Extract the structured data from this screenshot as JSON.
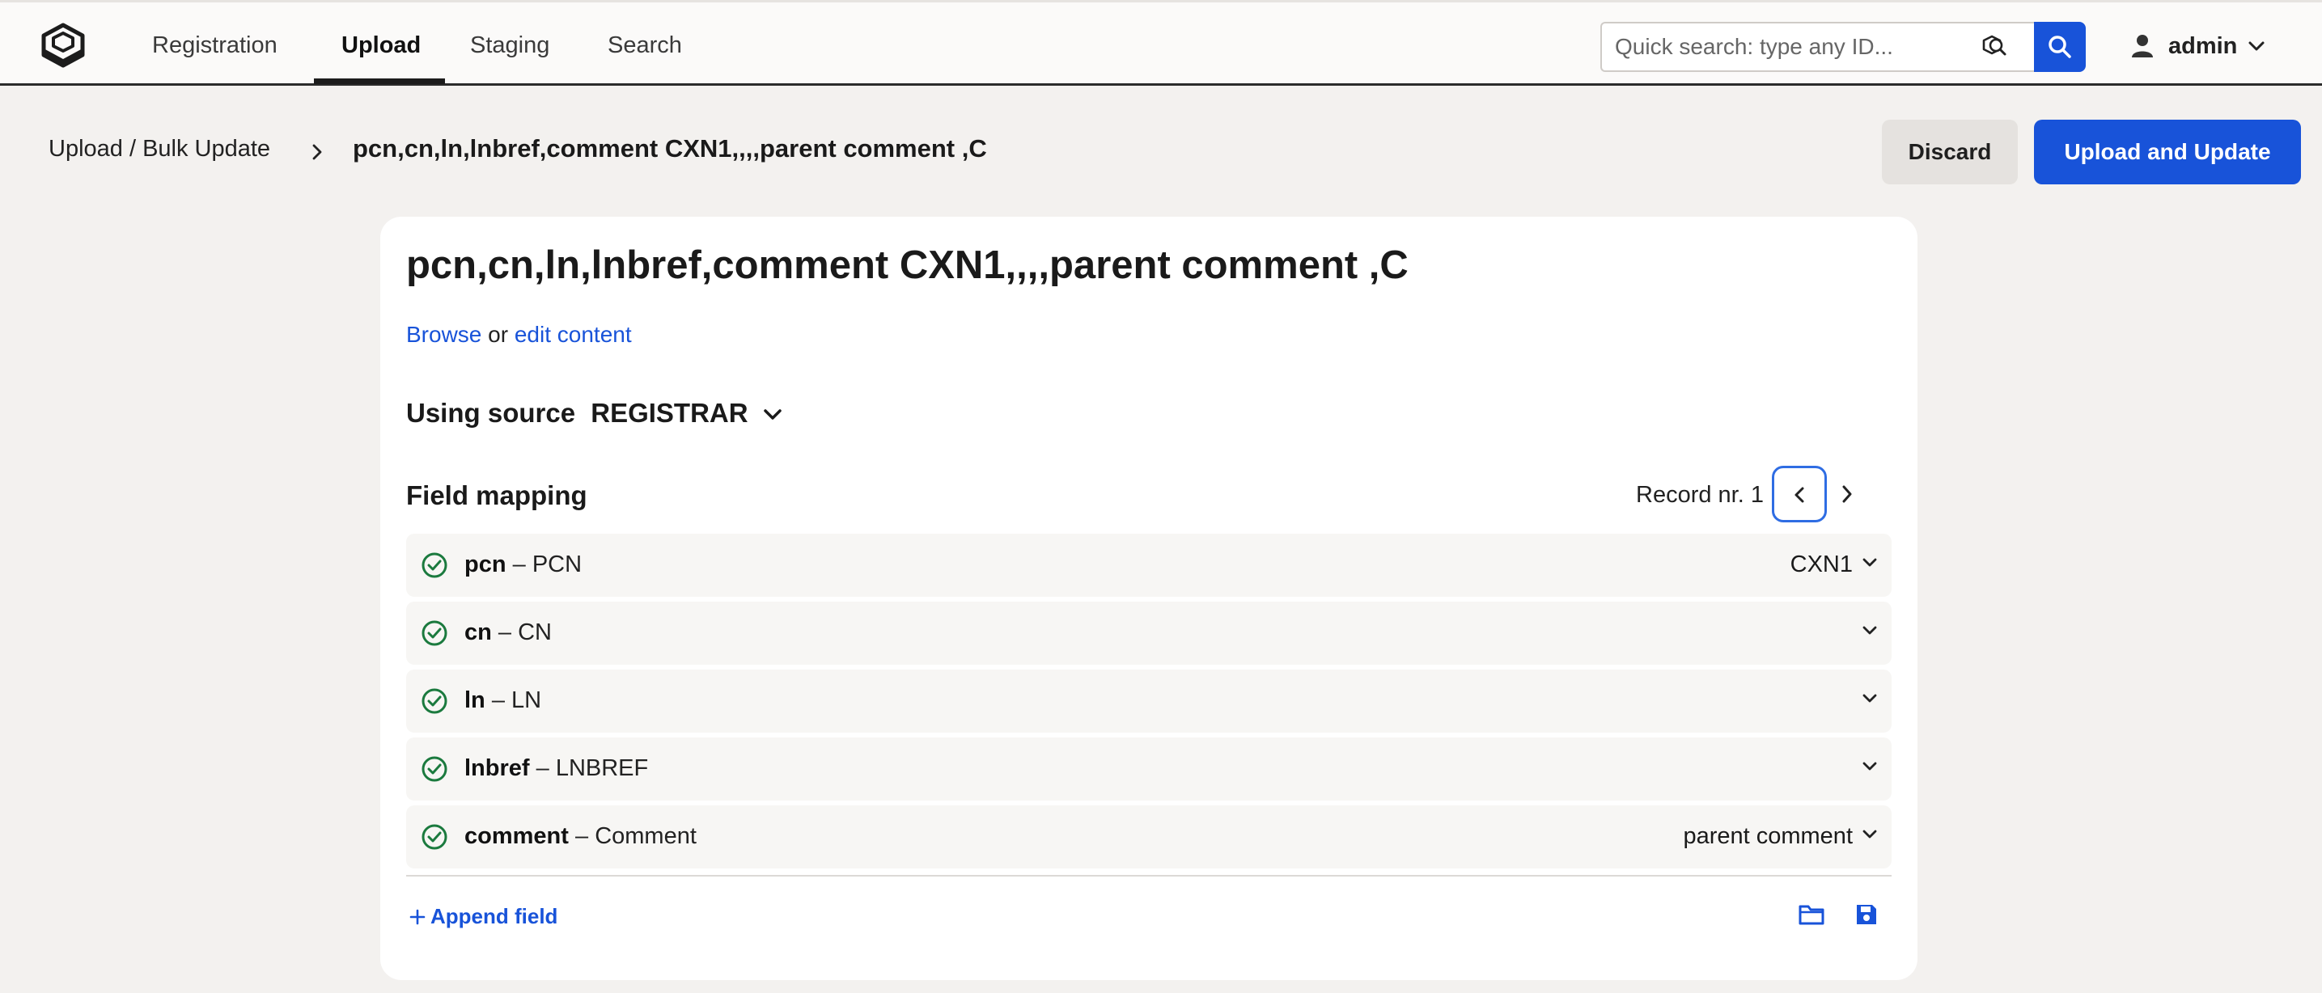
{
  "nav": {
    "tabs": [
      {
        "label": "Registration"
      },
      {
        "label": "Upload"
      },
      {
        "label": "Staging"
      },
      {
        "label": "Search"
      }
    ],
    "active_tab": "Upload",
    "search": {
      "placeholder": "Quick search: type any ID..."
    },
    "user": {
      "name": "admin"
    }
  },
  "breadcrumb": {
    "parent": "Upload / Bulk Update",
    "current": "pcn,cn,ln,lnbref,comment CXN1,,,,parent comment ,C"
  },
  "actions": {
    "discard_label": "Discard",
    "upload_label": "Upload and Update"
  },
  "card": {
    "title": "pcn,cn,ln,lnbref,comment CXN1,,,,parent comment ,C",
    "browse_label": "Browse",
    "or_text": "or",
    "edit_label": "edit content",
    "source_label": "Using source",
    "source_value": "REGISTRAR",
    "mapping_title": "Field mapping",
    "record_label": "Record nr. 1",
    "fields": [
      {
        "key": "pcn",
        "separator": "–",
        "name": "PCN",
        "value": "CXN1"
      },
      {
        "key": "cn",
        "separator": "–",
        "name": "CN",
        "value": ""
      },
      {
        "key": "ln",
        "separator": "–",
        "name": "LN",
        "value": ""
      },
      {
        "key": "lnbref",
        "separator": "–",
        "name": "LNBREF",
        "value": ""
      },
      {
        "key": "comment",
        "separator": "–",
        "name": "Comment",
        "value": "parent comment"
      }
    ],
    "append_label": "Append field"
  },
  "colors": {
    "accent": "#1853d9",
    "success": "#1b7a3e",
    "background": "#f3f1ef"
  }
}
